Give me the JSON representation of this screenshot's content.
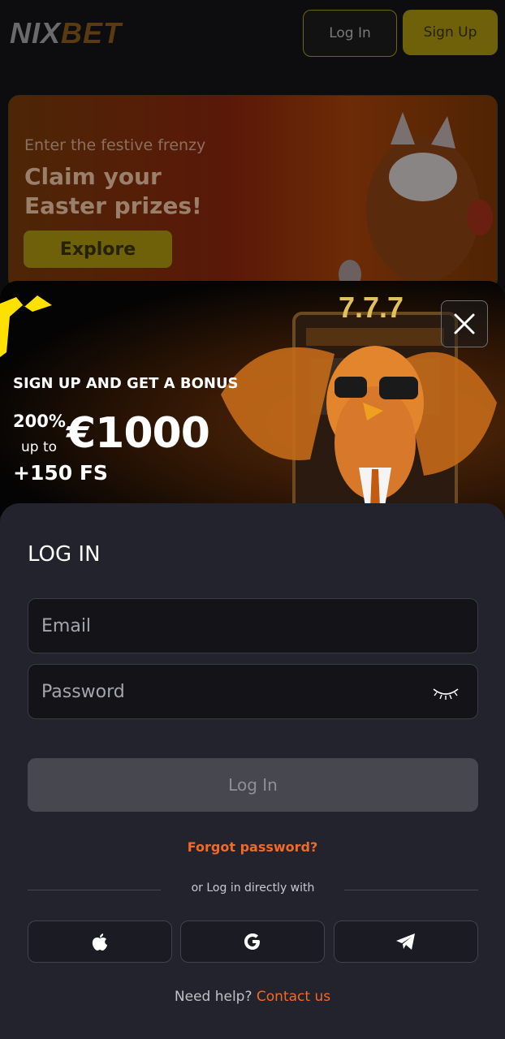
{
  "header": {
    "logo_part1": "NIX",
    "logo_part2": "BET",
    "login_label": "Log In",
    "signup_label": "Sign Up"
  },
  "promo": {
    "subtitle": "Enter the festive frenzy",
    "title": "Claim your Easter prizes!",
    "explore_label": "Explore"
  },
  "modal": {
    "headline": "SIGN UP AND GET A BONUS",
    "percent": "200%",
    "up_to": "up to",
    "amount": "€1000",
    "free_spins": "+150 FS",
    "close_icon": "close-icon"
  },
  "login": {
    "title": "LOG IN",
    "email_placeholder": "Email",
    "password_placeholder": "Password",
    "password_toggle_icon": "eye-closed-icon",
    "submit_label": "Log In",
    "forgot_label": "Forgot password?",
    "divider_text": "or Log in directly with",
    "social": [
      {
        "icon": "apple-icon"
      },
      {
        "icon": "google-icon"
      },
      {
        "icon": "telegram-icon"
      }
    ],
    "help_text": "Need help?",
    "contact_label": "Contact us"
  },
  "colors": {
    "accent": "#f16a28",
    "panel_bg": "#22232c",
    "button_disabled": "#46474f",
    "brand_yellow": "#6e610a"
  }
}
